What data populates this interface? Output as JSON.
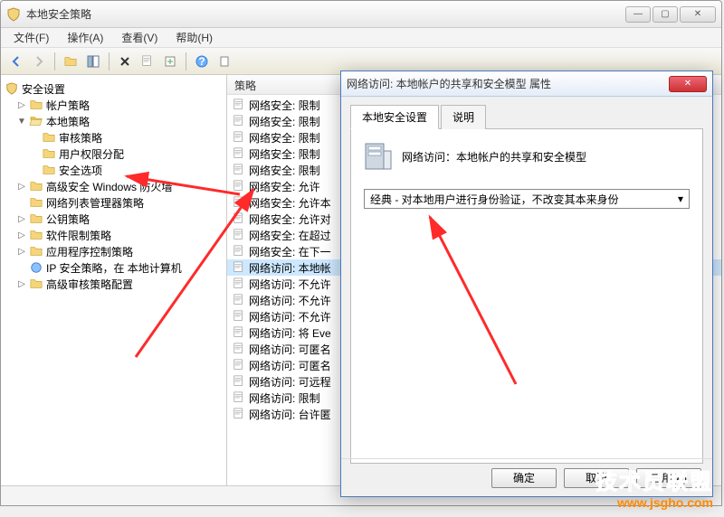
{
  "window": {
    "title": "本地安全策略"
  },
  "menu": {
    "file": "文件(F)",
    "action": "操作(A)",
    "view": "查看(V)",
    "help": "帮助(H)"
  },
  "tree": {
    "root": "安全设置",
    "account_policy": "帐户策略",
    "local_policy": "本地策略",
    "audit_policy": "审核策略",
    "user_rights": "用户权限分配",
    "security_options": "安全选项",
    "firewall": "高级安全 Windows 防火墙",
    "nlm": "网络列表管理器策略",
    "public_key": "公钥策略",
    "software_restrict": "软件限制策略",
    "app_control": "应用程序控制策略",
    "ipsec": "IP 安全策略，在 本地计算机",
    "adv_audit": "高级审核策略配置"
  },
  "list": {
    "header": "策略",
    "items": [
      "网络安全: 限制",
      "网络安全: 限制",
      "网络安全: 限制",
      "网络安全: 限制",
      "网络安全: 限制",
      "网络安全: 允许",
      "网络安全: 允许本",
      "网络安全: 允许对",
      "网络安全: 在超过",
      "网络安全: 在下一",
      "网络访问: 本地帐",
      "网络访问: 不允许",
      "网络访问: 不允许",
      "网络访问: 不允许",
      "网络访问: 将 Eve",
      "网络访问: 可匿名",
      "网络访问: 可匿名",
      "网络访问: 可远程",
      "网络访问: 限制",
      "网络访问: 台许匿"
    ],
    "selected_index": 10
  },
  "dialog": {
    "title": "网络访问: 本地帐户的共享和安全模型 属性",
    "tab1": "本地安全设置",
    "tab2": "说明",
    "policy_name": "网络访问：本地帐户的共享和安全模型",
    "dropdown_value": "经典 - 对本地用户进行身份验证，不改变其本来身份",
    "btn_ok": "确定",
    "btn_cancel": "取消",
    "btn_apply": "应用(A)"
  },
  "watermark": {
    "l1": "技术员联盟",
    "l2": "www.jsgho.com"
  }
}
